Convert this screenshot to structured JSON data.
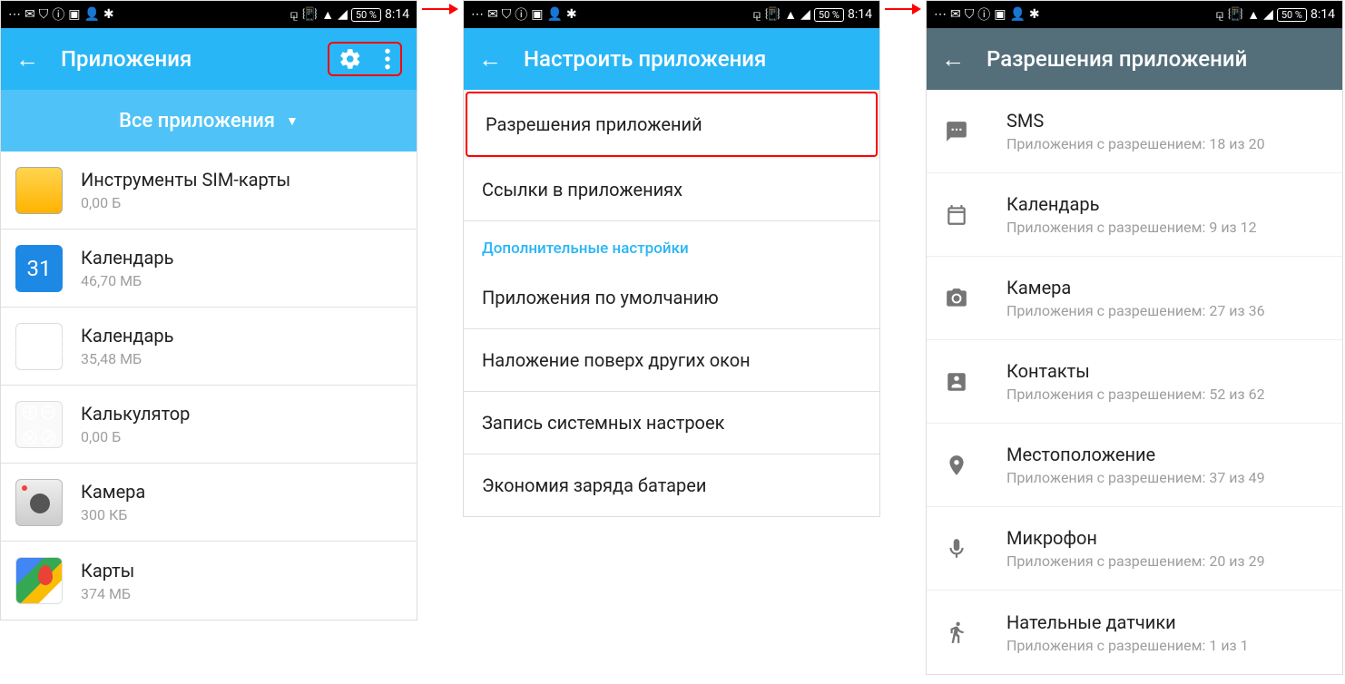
{
  "status": {
    "battery": "50 %",
    "time": "8:14"
  },
  "screen1": {
    "title": "Приложения",
    "filter": "Все приложения",
    "apps": [
      {
        "name": "Инструменты SIM-карты",
        "size": "0,00 Б",
        "icon": "sim"
      },
      {
        "name": "Календарь",
        "size": "46,70 МБ",
        "icon": "cal31"
      },
      {
        "name": "Календарь",
        "size": "35,48 МБ",
        "icon": "cal2"
      },
      {
        "name": "Калькулятор",
        "size": "0,00 Б",
        "icon": "calc"
      },
      {
        "name": "Камера",
        "size": "300 КБ",
        "icon": "cam"
      },
      {
        "name": "Карты",
        "size": "374 МБ",
        "icon": "maps"
      }
    ]
  },
  "screen2": {
    "title": "Настроить приложения",
    "items": [
      {
        "label": "Разрешения приложений",
        "highlight": true
      },
      {
        "label": "Ссылки в приложениях"
      }
    ],
    "section_header": "Дополнительные настройки",
    "more_items": [
      {
        "label": "Приложения по умолчанию"
      },
      {
        "label": "Наложение поверх других окон"
      },
      {
        "label": "Запись системных настроек"
      },
      {
        "label": "Экономия заряда батареи"
      }
    ]
  },
  "screen3": {
    "title": "Разрешения приложений",
    "perms": [
      {
        "name": "SMS",
        "sub": "Приложения с разрешением: 18 из 20",
        "icon": "sms"
      },
      {
        "name": "Календарь",
        "sub": "Приложения с разрешением: 9 из 12",
        "icon": "calendar"
      },
      {
        "name": "Камера",
        "sub": "Приложения с разрешением: 27 из 36",
        "icon": "camera"
      },
      {
        "name": "Контакты",
        "sub": "Приложения с разрешением: 52 из 62",
        "icon": "contacts"
      },
      {
        "name": "Местоположение",
        "sub": "Приложения с разрешением: 37 из 49",
        "icon": "location"
      },
      {
        "name": "Микрофон",
        "sub": "Приложения с разрешением: 20 из 29",
        "icon": "mic"
      },
      {
        "name": "Нательные датчики",
        "sub": "Приложения с разрешением: 1 из 1",
        "icon": "body"
      }
    ]
  }
}
